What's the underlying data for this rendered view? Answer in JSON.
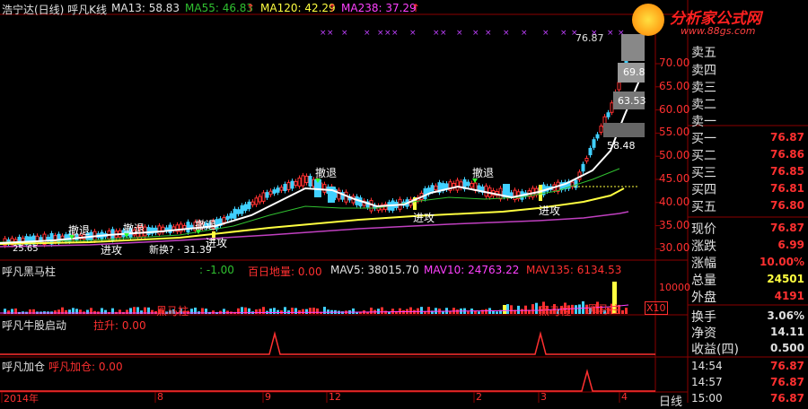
{
  "header": {
    "stock_title": "浩宁达(日线) 呼凡K线",
    "ma13": "MA13: 58.83",
    "ma55": "MA55: 46.83",
    "ma120": "MA120: 42.29",
    "ma238": "MA238: 37.29",
    "arrow": "↑"
  },
  "logo": {
    "title": "分析家公式网",
    "url": "www.88gs.com"
  },
  "price_axis": [
    "70.00",
    "65.00",
    "60.00",
    "55.00",
    "50.00",
    "45.00",
    "40.00",
    "35.00",
    "30.00"
  ],
  "chart_labels": {
    "high_price": "76.87",
    "p69": "69.8",
    "p63": "63.53",
    "p58": "58.48",
    "low_left": "25.65",
    "low_mid": "31.39",
    "retreat": "撤退",
    "attack": "进攻",
    "liutian": "新换? · 31.39"
  },
  "volume_panel": {
    "title": "呼凡黑马柱",
    "v1": ": -1.00",
    "v2": "百日地量: 0.00",
    "mav5": "MAV5: 38015.70",
    "mav10": "MAV10: 24763.22",
    "mav135": "MAV135: 6134.53",
    "axis_10000": "10000",
    "x10": "X10",
    "heima": "黑马柱"
  },
  "ind_qidong": {
    "title": "呼凡牛股启动",
    "value": "拉升: 0.00"
  },
  "ind_jiacang": {
    "title": "呼凡加仓",
    "value": "呼凡加仓: 0.00"
  },
  "date_axis": [
    "2014年",
    "8",
    "9",
    "12",
    "2",
    "3",
    "4"
  ],
  "period_label": "日线",
  "right_panel": {
    "sell_header": "卖五",
    "sell": [
      "卖四",
      "卖三",
      "卖二",
      "卖一"
    ],
    "buy": [
      {
        "label": "买一",
        "value": "76.87"
      },
      {
        "label": "买二",
        "value": "76.86"
      },
      {
        "label": "买三",
        "value": "76.85"
      },
      {
        "label": "买四",
        "value": "76.81"
      },
      {
        "label": "买五",
        "value": "76.80"
      }
    ],
    "stats": [
      {
        "label": "现价",
        "value": "76.87",
        "color": "#ff3030"
      },
      {
        "label": "涨跌",
        "value": "6.99",
        "color": "#ff3030"
      },
      {
        "label": "涨幅",
        "value": "10.00%",
        "color": "#ff3030"
      },
      {
        "label": "总量",
        "value": "24501",
        "color": "#ffff40"
      },
      {
        "label": "外盘",
        "value": "4191",
        "color": "#ff3030"
      }
    ],
    "stats2": [
      {
        "label": "换手",
        "value": "3.06%",
        "color": "#e0e0e0"
      },
      {
        "label": "净资",
        "value": "14.11",
        "color": "#e0e0e0"
      },
      {
        "label": "收益(四)",
        "value": "0.500",
        "color": "#e0e0e0"
      }
    ],
    "ticks": [
      {
        "time": "14:54",
        "value": "76.87"
      },
      {
        "time": "14:57",
        "value": "76.87"
      },
      {
        "time": "15:00",
        "value": "76.87"
      }
    ]
  },
  "colors": {
    "up": "#ff3030",
    "down": "#40d0ff",
    "ma13": "#ffffff",
    "ma55": "#30c030",
    "ma120": "#ffff40",
    "ma238": "#c040c0"
  }
}
